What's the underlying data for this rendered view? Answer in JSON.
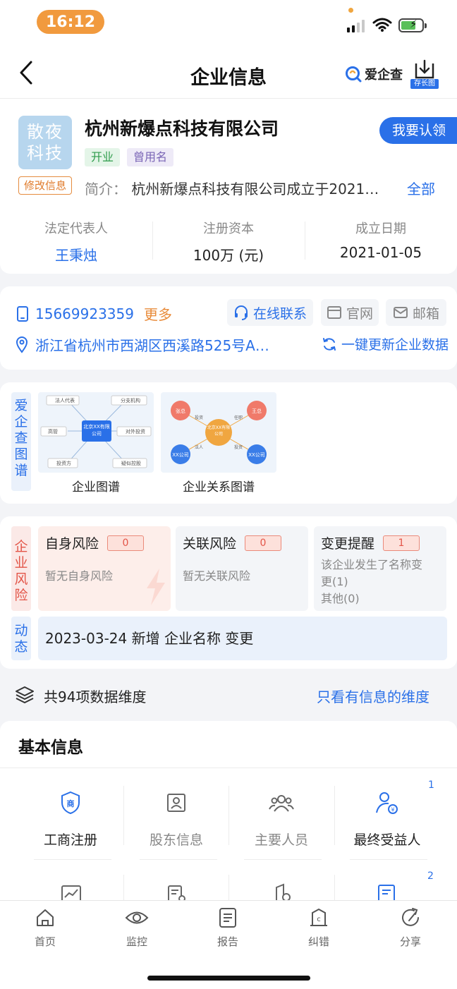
{
  "status_bar": {
    "time": "16:12"
  },
  "nav": {
    "title": "企业信息",
    "brand": "爱企查",
    "save_long_image": "存长图"
  },
  "company": {
    "logo_line1": "散夜",
    "logo_line2": "科技",
    "name": "杭州新爆点科技有限公司",
    "claim_button": "我要认领",
    "tags": [
      "开业",
      "曾用名"
    ],
    "edit_info": "修改信息",
    "intro_label": "简介：",
    "intro_text": "杭州新爆点科技有限公司成立于2021…",
    "intro_all": "全部",
    "stats": [
      {
        "label": "法定代表人",
        "value": "王秉烛"
      },
      {
        "label": "注册资本",
        "value": "100万 (元)"
      },
      {
        "label": "成立日期",
        "value": "2021-01-05"
      }
    ]
  },
  "contact": {
    "phone": "15669923359",
    "more": "更多",
    "online": "在线联系",
    "website": "官网",
    "email": "邮箱",
    "address": "浙江省杭州市西湖区西溪路525号A…",
    "refresh": "一键更新企业数据"
  },
  "graph": {
    "side_label": "爱企查图谱",
    "thumb1": {
      "caption": "企业图谱",
      "center": "北京XX有限公司",
      "nodes": [
        "法人代表",
        "分支机构",
        "高管",
        "对外投资",
        "投资方",
        "疑似控股"
      ]
    },
    "thumb2": {
      "caption": "企业关系图谱",
      "center": "北京XX有限公司",
      "nodes": [
        "张总",
        "王总",
        "XX公司",
        "XX公司"
      ],
      "edges": [
        "投资",
        "任职",
        "法人",
        "投资"
      ]
    }
  },
  "risk": {
    "side_label": "企业风险",
    "items": [
      {
        "title": "自身风险",
        "count": "0",
        "desc": "暂无自身风险"
      },
      {
        "title": "关联风险",
        "count": "0",
        "desc": "暂无关联风险"
      },
      {
        "title": "变更提醒",
        "count": "1",
        "desc_line1": "该企业发生了名称变",
        "desc_line2": "更(1)",
        "desc_line3": "其他(0)"
      }
    ],
    "dynamic_label": "动态",
    "dynamic_text": "2023-03-24 新增 企业名称 变更"
  },
  "dimensions": {
    "text": "共94项数据维度",
    "filter_link": "只看有信息的维度"
  },
  "basic": {
    "title": "基本信息",
    "items": [
      {
        "label": "工商注册",
        "badge": ""
      },
      {
        "label": "股东信息",
        "badge": ""
      },
      {
        "label": "主要人员",
        "badge": ""
      },
      {
        "label": "最终受益人",
        "badge": "1"
      }
    ],
    "row2_badge": "2"
  },
  "tabbar": {
    "items": [
      "首页",
      "监控",
      "报告",
      "纠错",
      "分享"
    ]
  }
}
